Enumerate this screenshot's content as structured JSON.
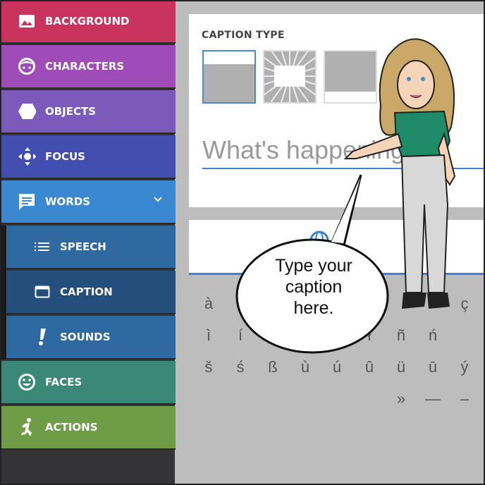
{
  "sidebar": {
    "items": [
      {
        "label": "BACKGROUND",
        "icon": "image-icon",
        "color": "#c8345e"
      },
      {
        "label": "CHARACTERS",
        "icon": "face-icon",
        "color": "#a04cb8"
      },
      {
        "label": "OBJECTS",
        "icon": "hexagon-icon",
        "color": "#7b5abc"
      },
      {
        "label": "FOCUS",
        "icon": "move-icon",
        "color": "#434fb0"
      },
      {
        "label": "WORDS",
        "icon": "chat-icon",
        "color": "#3a88d0"
      },
      {
        "label": "SPEECH",
        "icon": "list-icon",
        "color": "#2e69a2"
      },
      {
        "label": "CAPTION",
        "icon": "caption-icon",
        "color": "#244f7c"
      },
      {
        "label": "SOUNDS",
        "icon": "exclamation-icon",
        "color": "#2e69a2"
      },
      {
        "label": "FACES",
        "icon": "smiley-icon",
        "color": "#3a8878"
      },
      {
        "label": "ACTIONS",
        "icon": "running-icon",
        "color": "#6f9c46"
      }
    ]
  },
  "panel": {
    "caption_type_label": "CAPTION TYPE",
    "caption_types": [
      "top",
      "burst",
      "bottom"
    ],
    "selected_caption_type": "top",
    "input_placeholder": "What's happening?"
  },
  "accent": "#3b82d6",
  "special_chars": [
    [
      "à",
      "",
      "",
      "",
      "",
      "",
      "",
      "",
      "ç"
    ],
    [
      "ì",
      "í",
      "",
      "",
      "ę",
      "ł",
      "ñ",
      "ń",
      ""
    ],
    [
      "š",
      "ś",
      "ß",
      "ù",
      "ú",
      "û",
      "ü",
      "ū",
      "ý"
    ],
    [
      "",
      "",
      "",
      "",
      "",
      "",
      "»",
      "—",
      "–"
    ]
  ],
  "bubble": {
    "text": "Type your caption here."
  }
}
